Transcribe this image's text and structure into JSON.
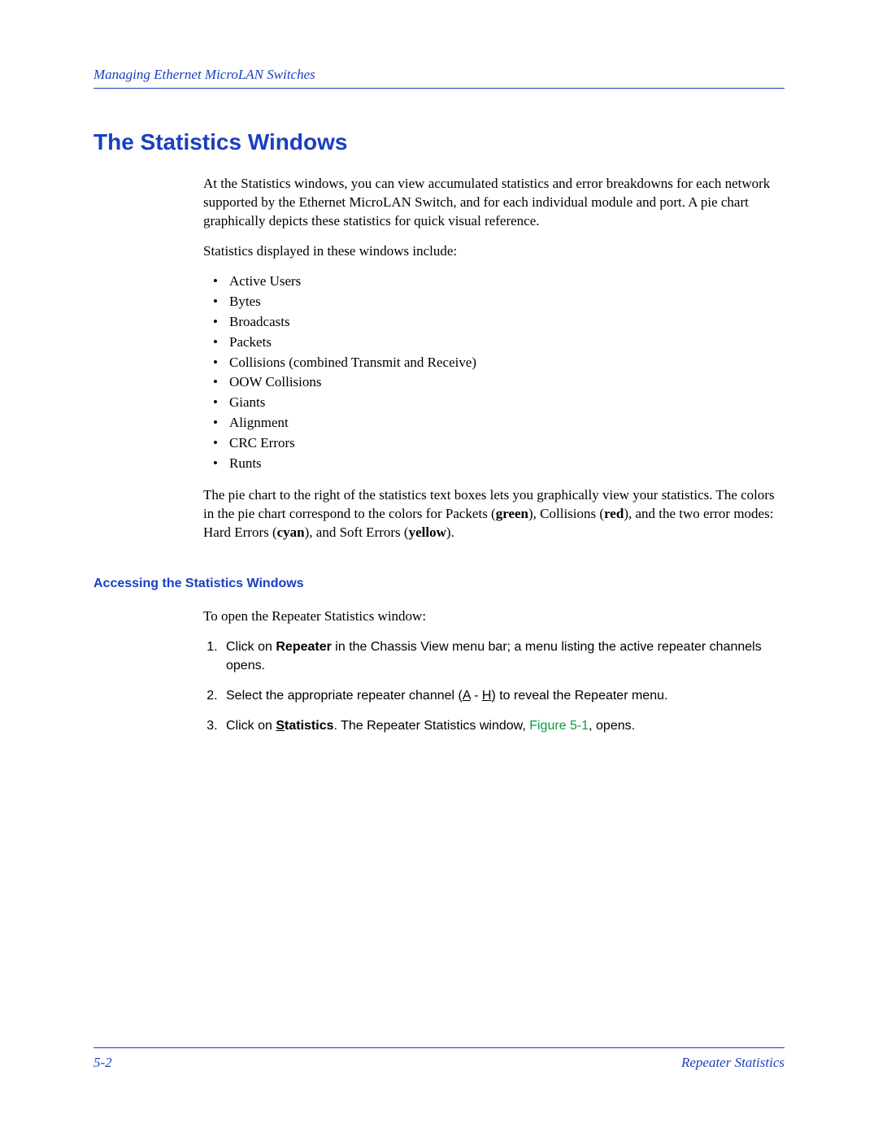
{
  "header": {
    "running_head": "Managing Ethernet MicroLAN Switches"
  },
  "section": {
    "title": "The Statistics Windows",
    "intro": "At the Statistics windows, you can view accumulated statistics and error breakdowns for each network supported by the Ethernet MicroLAN Switch, and for each individual module and port. A pie chart graphically depicts these statistics for quick visual reference.",
    "lead_in": "Statistics displayed in these windows include:",
    "stats": [
      "Active Users",
      "Bytes",
      "Broadcasts",
      "Packets",
      "Collisions (combined Transmit and Receive)",
      "OOW Collisions",
      "Giants",
      "Alignment",
      "CRC Errors",
      "Runts"
    ],
    "pie_para_parts": {
      "p1": "The pie chart to the right of the statistics text boxes lets you graphically view your statistics. The colors in the pie chart correspond to the colors for Packets (",
      "green": "green",
      "p2": "), Collisions (",
      "red": "red",
      "p3": "), and the two error modes: Hard Errors (",
      "cyan": "cyan",
      "p4": "), and Soft Errors (",
      "yellow": "yellow",
      "p5": ")."
    }
  },
  "subsection": {
    "title": "Accessing the Statistics Windows",
    "opener": "To open the Repeater Statistics window:",
    "steps": {
      "s1a": "Click on ",
      "s1b": "Repeater",
      "s1c": " in the Chassis View menu bar; a menu listing the active repeater channels opens.",
      "s2a": "Select the appropriate repeater channel (",
      "s2A": "A",
      "s2dash": " - ",
      "s2H": "H",
      "s2b": ") to reveal the Repeater menu.",
      "s3a": "Click on ",
      "s3S": "S",
      "s3rest": "tatistics",
      "s3b": ". The Repeater Statistics window, ",
      "s3fig": "Figure 5-1",
      "s3c": ", opens."
    }
  },
  "footer": {
    "page": "5-2",
    "chapter": "Repeater Statistics"
  }
}
